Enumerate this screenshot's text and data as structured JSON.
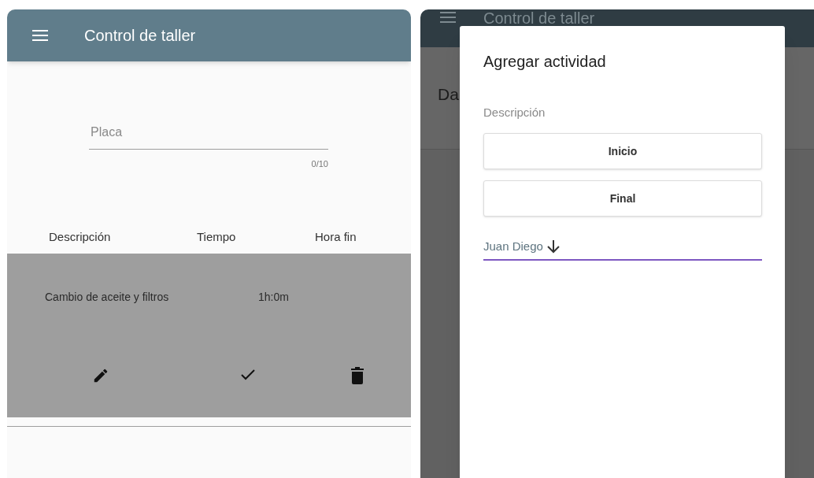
{
  "left_screen": {
    "app_bar": {
      "title": "Control de taller"
    },
    "plate_field": {
      "placeholder": "Placa",
      "counter": "0/10"
    },
    "table": {
      "columns": [
        "Descripción",
        "Tiempo",
        "Hora fin"
      ],
      "rows": [
        {
          "cells": [
            "Cambio de aceite y filtros",
            "1h:0m"
          ],
          "selected": true
        }
      ]
    }
  },
  "right_screen": {
    "app_bar": {
      "title": "Control de taller"
    },
    "partial_heading": "Da",
    "dialog": {
      "title": "Agregar actividad",
      "description_field": {
        "placeholder": "Descripción"
      },
      "buttons": [
        "Inicio",
        "Final"
      ],
      "select": {
        "value": "Juan Diego",
        "focused": true
      }
    }
  }
}
